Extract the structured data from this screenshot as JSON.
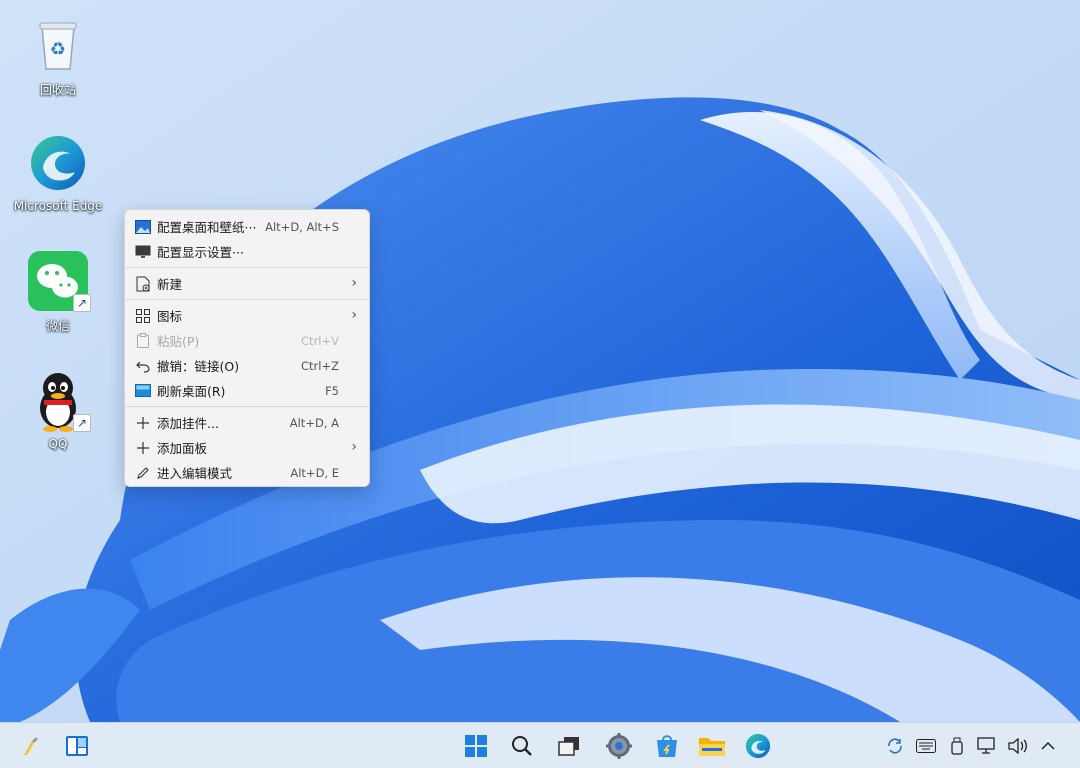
{
  "desktop": {
    "icons": [
      {
        "label": "回收站",
        "icon": "recycle-bin-icon"
      },
      {
        "label": "Microsoft Edge",
        "icon": "edge-icon"
      },
      {
        "label": "微信",
        "icon": "wechat-icon"
      },
      {
        "label": "QQ",
        "icon": "qq-icon"
      }
    ]
  },
  "context_menu": {
    "items": [
      {
        "label": "配置桌面和壁纸···",
        "shortcut": "Alt+D, Alt+S",
        "icon": "wallpaper-icon"
      },
      {
        "label": "配置显示设置···",
        "shortcut": "",
        "icon": "monitor-icon"
      },
      {
        "label": "新建",
        "shortcut": "",
        "icon": "new-file-icon"
      },
      {
        "label": "图标",
        "shortcut": "",
        "icon": "grid-icon"
      },
      {
        "label": "粘贴(P)",
        "shortcut": "Ctrl+V",
        "icon": "paste-icon",
        "disabled": true
      },
      {
        "label": "撤销：链接(O)",
        "shortcut": "Ctrl+Z",
        "icon": "undo-icon"
      },
      {
        "label": "刷新桌面(R)",
        "shortcut": "F5",
        "icon": "refresh-desktop-icon"
      },
      {
        "label": "添加挂件...",
        "shortcut": "Alt+D, A",
        "icon": "plus-icon"
      },
      {
        "label": "添加面板",
        "shortcut": "",
        "icon": "plus-icon"
      },
      {
        "label": "进入编辑模式",
        "shortcut": "Alt+D, E",
        "icon": "pencil-icon"
      }
    ]
  },
  "taskbar": {
    "left": [
      "pinned-app-icon",
      "widgets-icon"
    ],
    "center": [
      "windows-start-icon",
      "search-icon",
      "task-view-icon",
      "settings-gear-icon",
      "store-icon",
      "file-explorer-icon",
      "edge-icon"
    ],
    "tray": [
      "sync-icon",
      "keyboard-icon",
      "usb-icon",
      "network-icon",
      "volume-icon",
      "chevron-up-icon"
    ]
  },
  "colors": {
    "wallpaper_bg": "#c9ddf6",
    "bloom_blue": "#2f73e0",
    "menu_bg": "#f3f3f3",
    "taskbar_bg": "#dfeaf5"
  }
}
